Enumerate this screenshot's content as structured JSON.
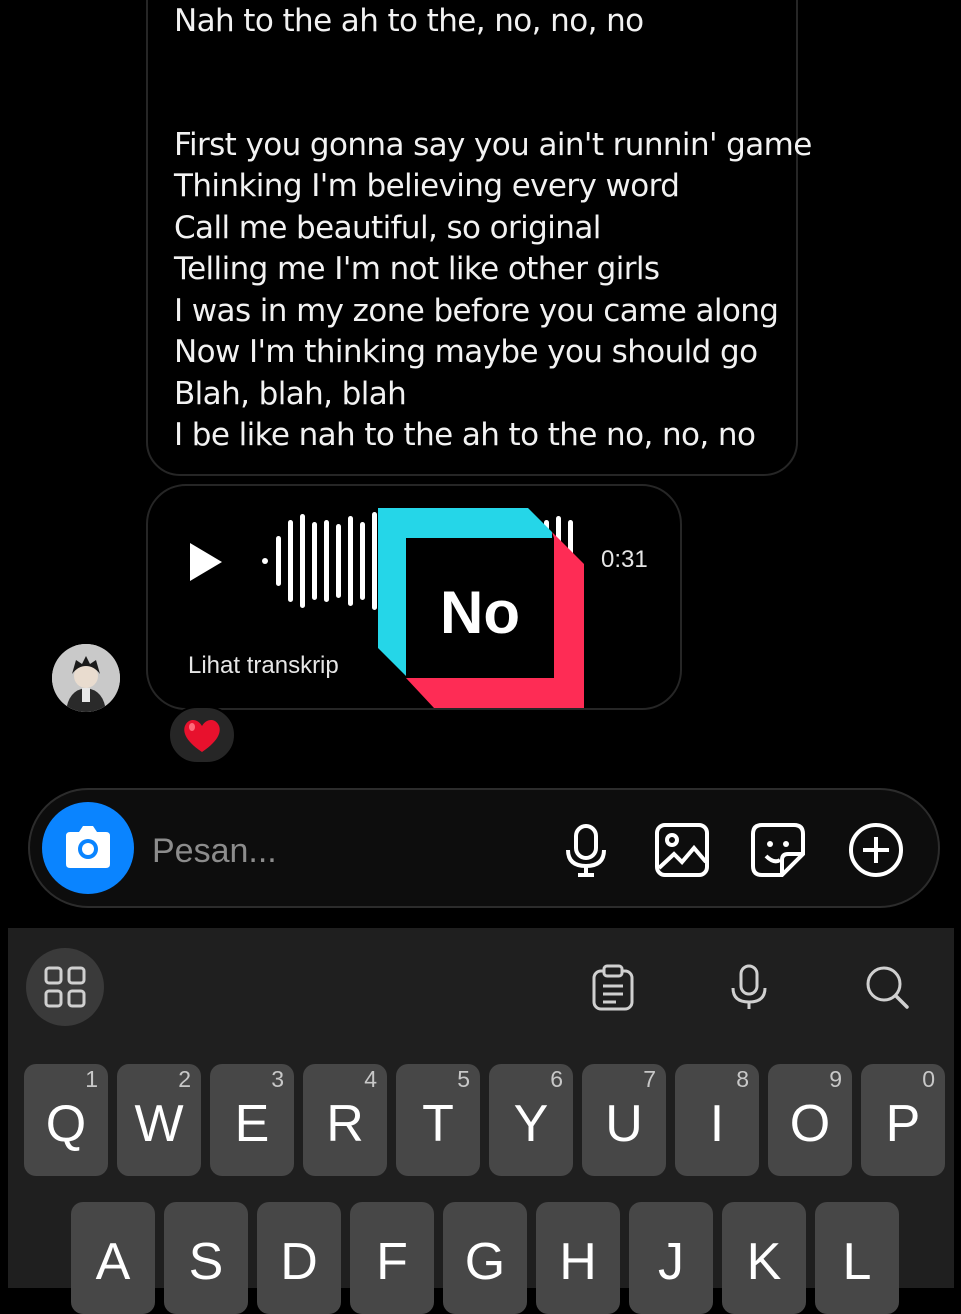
{
  "lyrics": {
    "lines": [
      "Nah to the ah to the, no, no, no",
      "",
      "",
      "First you gonna say you ain't runnin' game",
      "Thinking I'm believing every word",
      "Call me beautiful, so original",
      "Telling me I'm not like other girls",
      "I was in my zone before you came along",
      "Now I'm thinking maybe you should go",
      "Blah, blah, blah",
      "I be like nah to the ah to the no, no, no"
    ]
  },
  "voice_message": {
    "duration": "0:31",
    "transcript_label": "Lihat transkrip",
    "play_icon": "play-icon"
  },
  "reaction": {
    "emoji": "❤️"
  },
  "overlay": {
    "text": "No",
    "colors": {
      "cyan": "#25d6e8",
      "pink": "#fe2c55"
    }
  },
  "composer": {
    "placeholder": "Pesan...",
    "camera_color": "#0a84ff",
    "icons": [
      "microphone-icon",
      "gallery-icon",
      "sticker-icon",
      "add-icon"
    ]
  },
  "keyboard": {
    "toolbar_icons": [
      "apps-grid-icon",
      "clipboard-icon",
      "voice-input-icon",
      "search-icon"
    ],
    "row1": [
      {
        "letter": "Q",
        "num": "1"
      },
      {
        "letter": "W",
        "num": "2"
      },
      {
        "letter": "E",
        "num": "3"
      },
      {
        "letter": "R",
        "num": "4"
      },
      {
        "letter": "T",
        "num": "5"
      },
      {
        "letter": "Y",
        "num": "6"
      },
      {
        "letter": "U",
        "num": "7"
      },
      {
        "letter": "I",
        "num": "8"
      },
      {
        "letter": "O",
        "num": "9"
      },
      {
        "letter": "P",
        "num": "0"
      }
    ],
    "row2": [
      "A",
      "S",
      "D",
      "F",
      "G",
      "H",
      "J",
      "K",
      "L"
    ]
  }
}
